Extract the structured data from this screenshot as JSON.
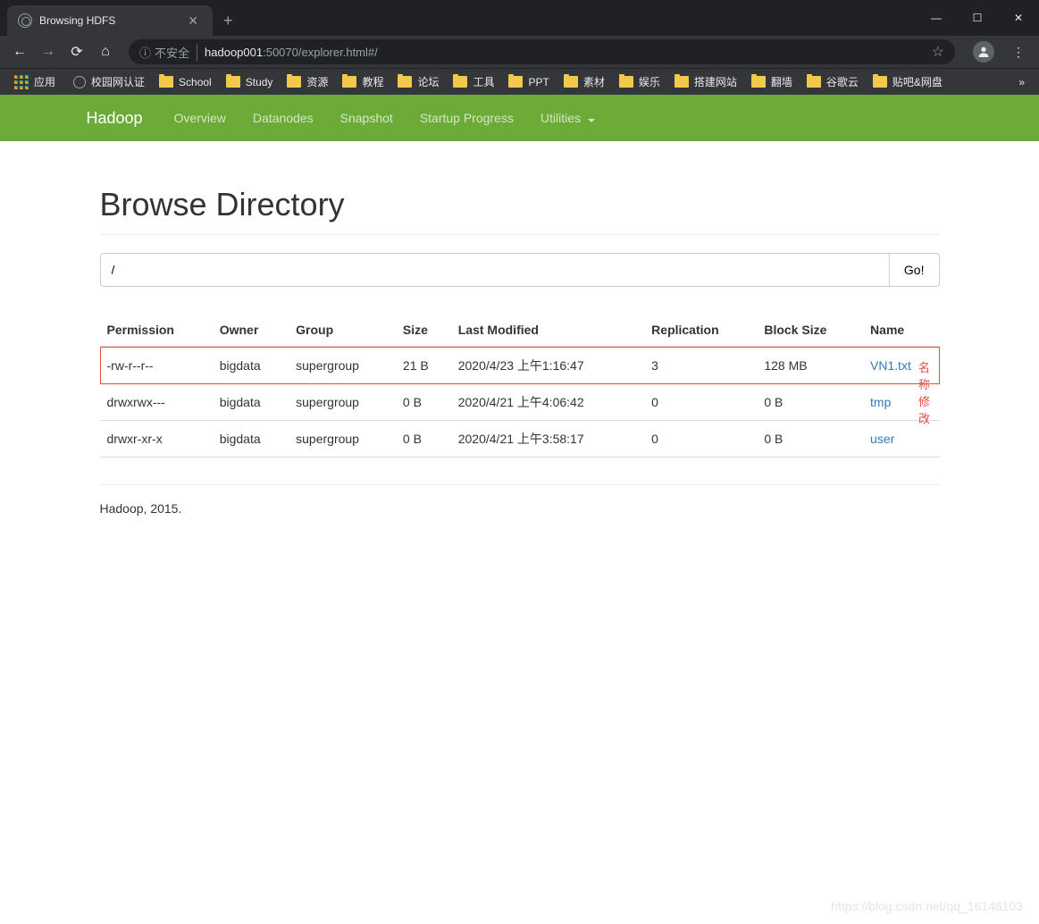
{
  "browser": {
    "tab_title": "Browsing HDFS",
    "url_insecure_label": "不安全",
    "url_host": "hadoop001",
    "url_rest": ":50070/explorer.html#/",
    "win": {
      "min": "—",
      "max": "☐",
      "close": "✕"
    },
    "bookmarks": {
      "apps": "应用",
      "items": [
        {
          "label": "校园网认证",
          "type": "globe"
        },
        {
          "label": "School",
          "type": "folder"
        },
        {
          "label": "Study",
          "type": "folder"
        },
        {
          "label": "资源",
          "type": "folder"
        },
        {
          "label": "教程",
          "type": "folder"
        },
        {
          "label": "论坛",
          "type": "folder"
        },
        {
          "label": "工具",
          "type": "folder"
        },
        {
          "label": "PPT",
          "type": "folder"
        },
        {
          "label": "素材",
          "type": "folder"
        },
        {
          "label": "娱乐",
          "type": "folder"
        },
        {
          "label": "搭建网站",
          "type": "folder"
        },
        {
          "label": "翻墙",
          "type": "folder"
        },
        {
          "label": "谷歌云",
          "type": "folder"
        },
        {
          "label": "贴吧&网盘",
          "type": "folder"
        }
      ]
    }
  },
  "nav": {
    "brand": "Hadoop",
    "items": [
      "Overview",
      "Datanodes",
      "Snapshot",
      "Startup Progress",
      "Utilities"
    ]
  },
  "page": {
    "title": "Browse Directory",
    "path_value": "/",
    "go_label": "Go!",
    "footer": "Hadoop, 2015."
  },
  "table": {
    "headers": [
      "Permission",
      "Owner",
      "Group",
      "Size",
      "Last Modified",
      "Replication",
      "Block Size",
      "Name"
    ],
    "rows": [
      {
        "permission": "-rw-r--r--",
        "owner": "bigdata",
        "group": "supergroup",
        "size": "21 B",
        "modified": "2020/4/23 上午1:16:47",
        "replication": "3",
        "blocksize": "128 MB",
        "name": "VN1.txt",
        "highlight": true,
        "annotation": "名称修改"
      },
      {
        "permission": "drwxrwx---",
        "owner": "bigdata",
        "group": "supergroup",
        "size": "0 B",
        "modified": "2020/4/21 上午4:06:42",
        "replication": "0",
        "blocksize": "0 B",
        "name": "tmp",
        "highlight": false
      },
      {
        "permission": "drwxr-xr-x",
        "owner": "bigdata",
        "group": "supergroup",
        "size": "0 B",
        "modified": "2020/4/21 上午3:58:17",
        "replication": "0",
        "blocksize": "0 B",
        "name": "user",
        "highlight": false
      }
    ]
  },
  "watermark": "https://blog.csdn.net/qq_16146103"
}
